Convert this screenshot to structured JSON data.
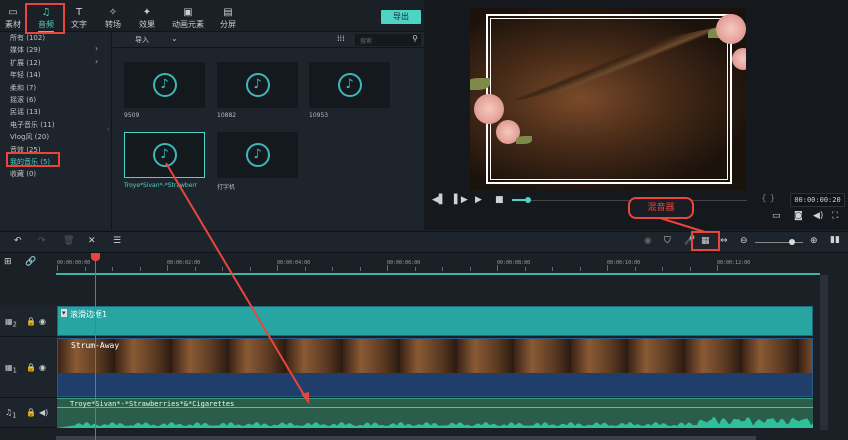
{
  "tabs": [
    {
      "label": "素材",
      "icon": "folder-icon"
    },
    {
      "label": "音频",
      "icon": "music-note-icon"
    },
    {
      "label": "文字",
      "icon": "text-icon"
    },
    {
      "label": "转场",
      "icon": "transition-icon"
    },
    {
      "label": "效果",
      "icon": "effects-icon"
    },
    {
      "label": "动画元素",
      "icon": "image-icon"
    },
    {
      "label": "分屏",
      "icon": "split-screen-icon"
    }
  ],
  "export_label": "导出",
  "categories": [
    "所有 (102)",
    "媒体 (29)",
    "扩展 (12)",
    "年轻 (14)",
    "柔和 (7)",
    "摇滚 (6)",
    "民谣 (13)",
    "电子音乐 (11)",
    "Vlog风 (20)",
    "音效 (25)",
    "我的音乐 (5)",
    "收藏 (0)"
  ],
  "selected_category": "我的音乐 (5)",
  "import_label": "导入",
  "search_placeholder": "搜索",
  "media_items": [
    "9509",
    "10882",
    "10953",
    "Troye*Sivan*-*Strawberr",
    "打字机"
  ],
  "timecode": "00:00:00:20",
  "callout": "混音器",
  "ruler": [
    "00:00:00:00",
    "00:00:02:00",
    "00:00:04:00",
    "00:00:06:00",
    "00:00:08:00",
    "00:00:10:00",
    "00:00:12:00"
  ],
  "tracks": {
    "overlay": {
      "num": "2",
      "clip": "滚滑边框1"
    },
    "video": {
      "num": "1",
      "clip": "Strum-Away"
    },
    "audio": {
      "num": "1",
      "clip": "Troye*Sivan*-*Strawberries*&*Cigarettes"
    }
  },
  "colors": {
    "accent": "#4fd3c4",
    "annotation": "#e8463c",
    "overlay_clip": "#26a5a3",
    "video_clip": "#1f3f6a",
    "audio_clip": "#2a5e4a"
  }
}
